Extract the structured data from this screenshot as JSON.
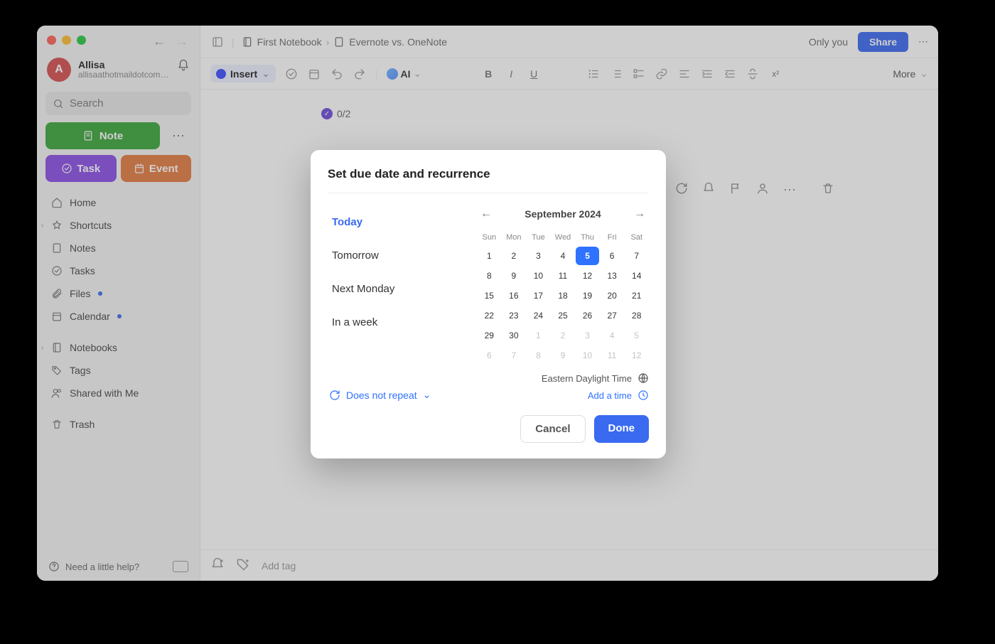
{
  "user": {
    "initial": "A",
    "name": "Allisa",
    "email": "allisaathotmaildotcom@g..."
  },
  "search": {
    "placeholder": "Search"
  },
  "buttons": {
    "note": "Note",
    "task": "Task",
    "event": "Event"
  },
  "nav": {
    "home": "Home",
    "shortcuts": "Shortcuts",
    "notes": "Notes",
    "tasks": "Tasks",
    "files": "Files",
    "calendar": "Calendar",
    "notebooks": "Notebooks",
    "tags": "Tags",
    "shared": "Shared with Me",
    "trash": "Trash"
  },
  "footer": {
    "help": "Need a little help?"
  },
  "breadcrumb": {
    "notebook": "First Notebook",
    "note": "Evernote vs. OneNote"
  },
  "header": {
    "only_you": "Only you",
    "share": "Share"
  },
  "toolbar": {
    "insert": "Insert",
    "ai": "AI",
    "more": "More"
  },
  "note": {
    "task_count": "0/2"
  },
  "bottom": {
    "add_tag": "Add tag"
  },
  "modal": {
    "title": "Set due date and recurrence",
    "quick": {
      "today": "Today",
      "tomorrow": "Tomorrow",
      "next_monday": "Next Monday",
      "in_a_week": "In a week"
    },
    "month": "September 2024",
    "weekdays": [
      "Sun",
      "Mon",
      "Tue",
      "Wed",
      "Thu",
      "Fri",
      "Sat"
    ],
    "days": [
      {
        "n": 1
      },
      {
        "n": 2
      },
      {
        "n": 3
      },
      {
        "n": 4
      },
      {
        "n": 5,
        "sel": true
      },
      {
        "n": 6
      },
      {
        "n": 7
      },
      {
        "n": 8
      },
      {
        "n": 9
      },
      {
        "n": 10
      },
      {
        "n": 11
      },
      {
        "n": 12
      },
      {
        "n": 13
      },
      {
        "n": 14
      },
      {
        "n": 15
      },
      {
        "n": 16
      },
      {
        "n": 17
      },
      {
        "n": 18
      },
      {
        "n": 19
      },
      {
        "n": 20
      },
      {
        "n": 21
      },
      {
        "n": 22
      },
      {
        "n": 23
      },
      {
        "n": 24
      },
      {
        "n": 25
      },
      {
        "n": 26
      },
      {
        "n": 27
      },
      {
        "n": 28
      },
      {
        "n": 29
      },
      {
        "n": 30
      },
      {
        "n": 1,
        "mute": true
      },
      {
        "n": 2,
        "mute": true
      },
      {
        "n": 3,
        "mute": true
      },
      {
        "n": 4,
        "mute": true
      },
      {
        "n": 5,
        "mute": true
      },
      {
        "n": 6,
        "mute": true
      },
      {
        "n": 7,
        "mute": true
      },
      {
        "n": 8,
        "mute": true
      },
      {
        "n": 9,
        "mute": true
      },
      {
        "n": 10,
        "mute": true
      },
      {
        "n": 11,
        "mute": true
      },
      {
        "n": 12,
        "mute": true
      }
    ],
    "repeat": "Does not repeat",
    "timezone": "Eastern Daylight Time",
    "add_time": "Add a time",
    "cancel": "Cancel",
    "done": "Done"
  }
}
